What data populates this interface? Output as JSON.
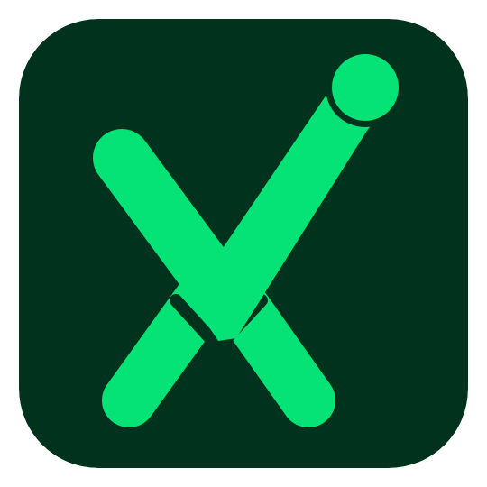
{
  "app_icon": {
    "name": "app-icon",
    "description_role": "logo",
    "colors": {
      "background": "#00321d",
      "mark": "#05e276",
      "gap": "#00321d",
      "page": "#ffffff"
    },
    "glyph": "x-checkmark-logo"
  }
}
